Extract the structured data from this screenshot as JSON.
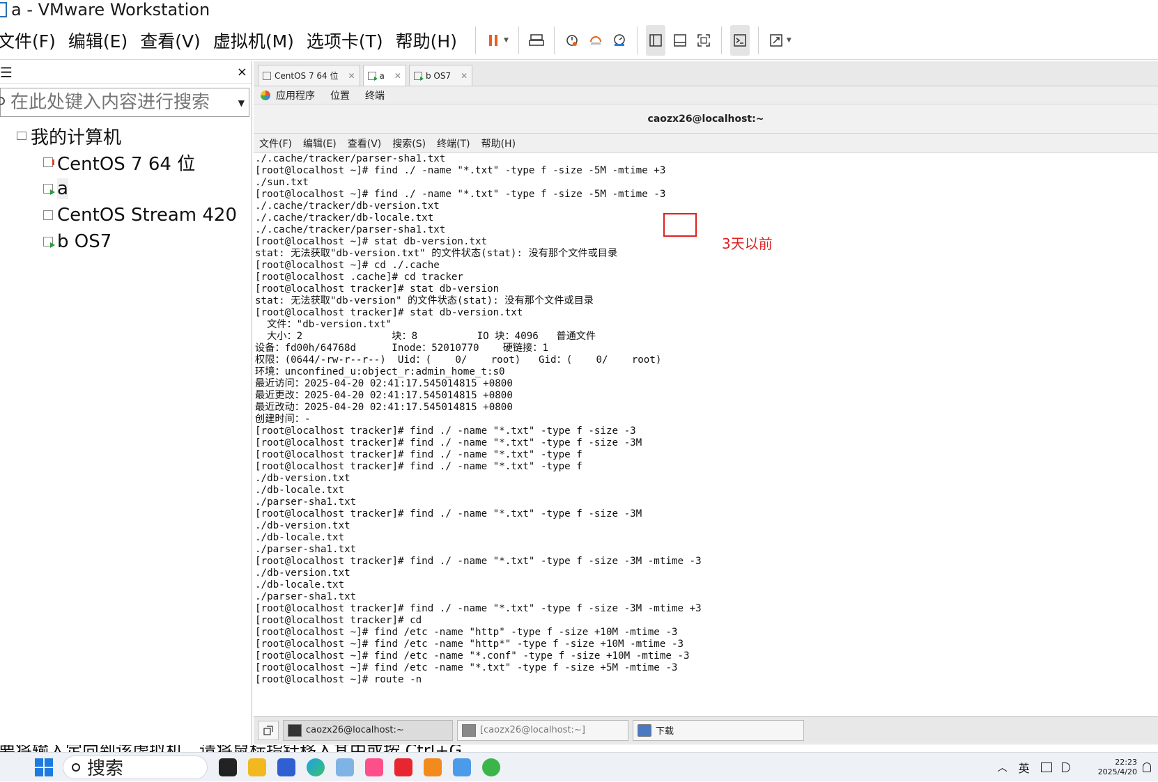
{
  "window": {
    "title": "a - VMware Workstation"
  },
  "menubar": {
    "items": [
      "文件(F)",
      "编辑(E)",
      "查看(V)",
      "虚拟机(M)",
      "选项卡(T)",
      "帮助(H)"
    ]
  },
  "toolbar": {
    "icons": [
      "pause-icon",
      "send-ctrl-alt-del-icon",
      "snapshot-icon",
      "revert-snapshot-icon",
      "snapshot-manager-icon",
      "library-view-icon",
      "thumbnail-bar-icon",
      "fullscreen-icon",
      "console-view-icon",
      "stretch-icon"
    ],
    "pause_color": "#e8611a"
  },
  "library": {
    "search_placeholder": "在此处键入内容进行搜索",
    "root_label": "我的计算机",
    "items": [
      {
        "label": "CentOS 7 64 位",
        "state": "suspended"
      },
      {
        "label": "a",
        "state": "running"
      },
      {
        "label": "CentOS Stream 420",
        "state": "off"
      },
      {
        "label": "b OS7",
        "state": "running"
      }
    ]
  },
  "tabs": [
    {
      "label": "CentOS 7 64 位",
      "active": false
    },
    {
      "label": "a",
      "active": true
    },
    {
      "label": "b OS7",
      "active": false
    }
  ],
  "gnome_panel": {
    "items": [
      "应用程序",
      "位置",
      "终端"
    ]
  },
  "terminal": {
    "title": "caozx26@localhost:~",
    "menu": [
      "文件(F)",
      "编辑(E)",
      "查看(V)",
      "搜索(S)",
      "终端(T)",
      "帮助(H)"
    ],
    "lines": [
      "./.cache/tracker/parser-sha1.txt",
      "[root@localhost ~]# find ./ -name \"*.txt\" -type f -size -5M -mtime +3",
      "./sun.txt",
      "[root@localhost ~]# find ./ -name \"*.txt\" -type f -size -5M -mtime -3",
      "./.cache/tracker/db-version.txt",
      "./.cache/tracker/db-locale.txt",
      "./.cache/tracker/parser-sha1.txt",
      "[root@localhost ~]# stat db-version.txt",
      "stat: 无法获取\"db-version.txt\" 的文件状态(stat): 没有那个文件或目录",
      "[root@localhost ~]# cd ./.cache",
      "[root@localhost .cache]# cd tracker",
      "[root@localhost tracker]# stat db-version",
      "stat: 无法获取\"db-version\" 的文件状态(stat): 没有那个文件或目录",
      "[root@localhost tracker]# stat db-version.txt",
      "  文件：\"db-version.txt\"",
      "  大小：2               块：8          IO 块：4096   普通文件",
      "设备：fd00h/64768d      Inode：52010770    硬链接：1",
      "权限：(0644/-rw-r--r--)  Uid：(    0/    root)   Gid：(    0/    root)",
      "环境：unconfined_u:object_r:admin_home_t:s0",
      "最近访问：2025-04-20 02:41:17.545014815 +0800",
      "最近更改：2025-04-20 02:41:17.545014815 +0800",
      "最近改动：2025-04-20 02:41:17.545014815 +0800",
      "创建时间：-",
      "[root@localhost tracker]# find ./ -name \"*.txt\" -type f -size -3",
      "[root@localhost tracker]# find ./ -name \"*.txt\" -type f -size -3M",
      "[root@localhost tracker]# find ./ -name \"*.txt\" -type f",
      "[root@localhost tracker]# find ./ -name \"*.txt\" -type f",
      "./db-version.txt",
      "./db-locale.txt",
      "./parser-sha1.txt",
      "[root@localhost tracker]# find ./ -name \"*.txt\" -type f -size -3M",
      "./db-version.txt",
      "./db-locale.txt",
      "./parser-sha1.txt",
      "[root@localhost tracker]# find ./ -name \"*.txt\" -type f -size -3M -mtime -3",
      "./db-version.txt",
      "./db-locale.txt",
      "./parser-sha1.txt",
      "[root@localhost tracker]# find ./ -name \"*.txt\" -type f -size -3M -mtime +3",
      "[root@localhost tracker]# cd",
      "[root@localhost ~]# find /etc -name \"http\" -type f -size +10M -mtime -3",
      "[root@localhost ~]# find /etc -name \"http*\" -type f -size +10M -mtime -3",
      "[root@localhost ~]# find /etc -name \"*.conf\" -type f -size +10M -mtime -3",
      "[root@localhost ~]# find /etc -name \"*.txt\" -type f -size +5M -mtime -3",
      "[root@localhost ~]# route -n"
    ],
    "annotation": "3天以前",
    "annotation_color": "#e02020"
  },
  "guest_taskbar": {
    "tasks": [
      {
        "label": "caozx26@localhost:~",
        "active": true
      },
      {
        "label": "[caozx26@localhost:~]",
        "active": false
      },
      {
        "label": "下载",
        "active": false
      }
    ]
  },
  "statusbar": {
    "text": "要将输入定向到该虚拟机，请将鼠标指针移入其中或按 Ctrl+G。"
  },
  "win_taskbar": {
    "search_label": "搜索",
    "lang": "英",
    "time": "22:23",
    "date": "2025/4/20"
  }
}
